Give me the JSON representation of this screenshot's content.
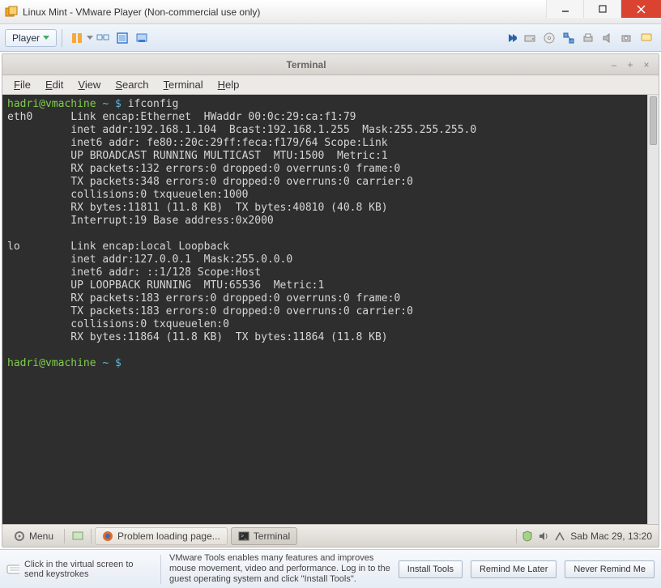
{
  "window": {
    "title": "Linux Mint - VMware Player (Non-commercial use only)"
  },
  "vm_toolbar": {
    "player_label": "Player"
  },
  "guest_window": {
    "title": "Terminal",
    "menu": {
      "file": "File",
      "edit": "Edit",
      "view": "View",
      "search": "Search",
      "terminal": "Terminal",
      "help": "Help"
    }
  },
  "terminal": {
    "prompt1_user": "hadri@vmachine",
    "prompt1_path": "~ $",
    "prompt1_cmd": "ifconfig",
    "output": "eth0      Link encap:Ethernet  HWaddr 00:0c:29:ca:f1:79\n          inet addr:192.168.1.104  Bcast:192.168.1.255  Mask:255.255.255.0\n          inet6 addr: fe80::20c:29ff:feca:f179/64 Scope:Link\n          UP BROADCAST RUNNING MULTICAST  MTU:1500  Metric:1\n          RX packets:132 errors:0 dropped:0 overruns:0 frame:0\n          TX packets:348 errors:0 dropped:0 overruns:0 carrier:0\n          collisions:0 txqueuelen:1000\n          RX bytes:11811 (11.8 KB)  TX bytes:40810 (40.8 KB)\n          Interrupt:19 Base address:0x2000\n\nlo        Link encap:Local Loopback\n          inet addr:127.0.0.1  Mask:255.0.0.0\n          inet6 addr: ::1/128 Scope:Host\n          UP LOOPBACK RUNNING  MTU:65536  Metric:1\n          RX packets:183 errors:0 dropped:0 overruns:0 frame:0\n          TX packets:183 errors:0 dropped:0 overruns:0 carrier:0\n          collisions:0 txqueuelen:0\n          RX bytes:11864 (11.8 KB)  TX bytes:11864 (11.8 KB)\n",
    "prompt2_user": "hadri@vmachine",
    "prompt2_path": "~ $"
  },
  "mint_taskbar": {
    "menu_label": "Menu",
    "task1": "Problem loading page...",
    "task2": "Terminal",
    "clock": "Sab Mac 29, 13:20"
  },
  "vm_bottom": {
    "hint": "Click in the virtual screen to send keystrokes",
    "message": "VMware Tools enables many features and improves mouse movement, video and performance. Log in to the guest operating system and click \"Install Tools\".",
    "install": "Install Tools",
    "remind": "Remind Me Later",
    "never": "Never Remind Me"
  }
}
